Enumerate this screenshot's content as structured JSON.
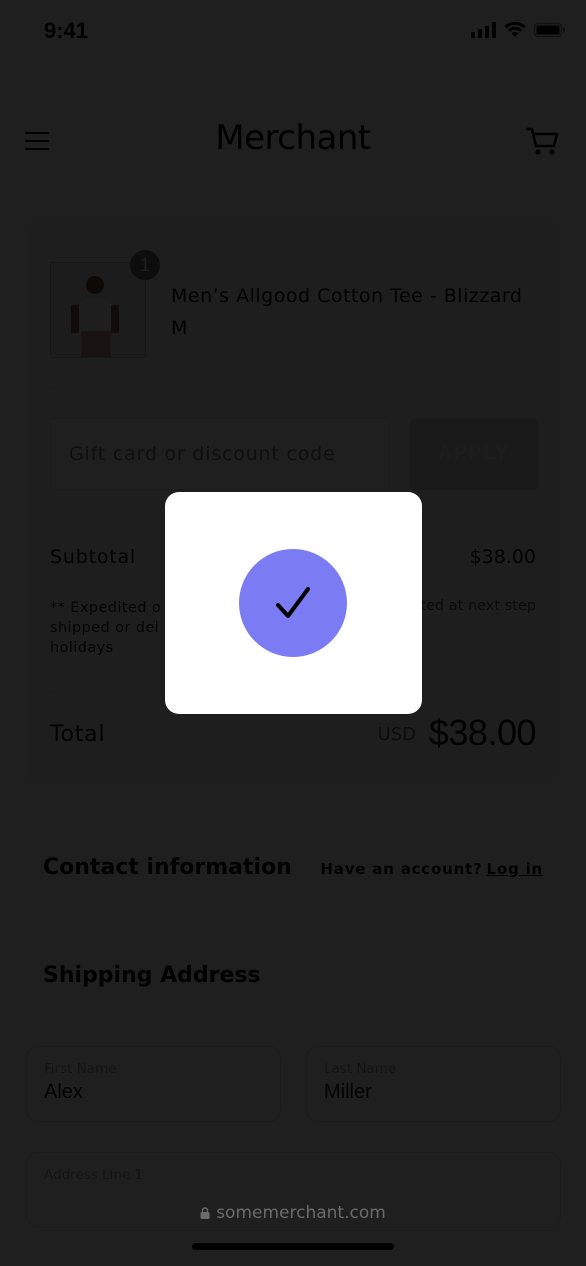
{
  "status_bar": {
    "time": "9:41"
  },
  "header": {
    "brand": "Merchant"
  },
  "order": {
    "quantity_badge": "1",
    "product_name": "Men’s Allgood Cotton Tee - Blizzard",
    "product_variant": "M",
    "discount": {
      "placeholder": "Gift card or discount code",
      "apply_label": "APPLY"
    },
    "subtotal_label": "Subtotal",
    "subtotal_value": "$38.00",
    "shipping_note_visible_line1": "** Expedited o",
    "shipping_note_visible_line2": "shipped or del",
    "shipping_note_visible_line3": "holidays",
    "shipping_estimate_visible": "ted at next step",
    "total_label": "Total",
    "total_currency": "USD",
    "total_value": "$38.00"
  },
  "contact": {
    "heading": "Contact information",
    "account_prompt": "Have an account?",
    "login_label": "Log in"
  },
  "shipping": {
    "heading": "Shipping Address",
    "first_name_label": "First Name",
    "first_name_value": "Alex",
    "last_name_label": "Last Name",
    "last_name_value": "Miller",
    "address_line_label": "Address Line 1"
  },
  "browser": {
    "url": "somemerchant.com"
  },
  "modal": {
    "icon": "checkmark-icon",
    "accent_color": "#7b7cf4"
  }
}
